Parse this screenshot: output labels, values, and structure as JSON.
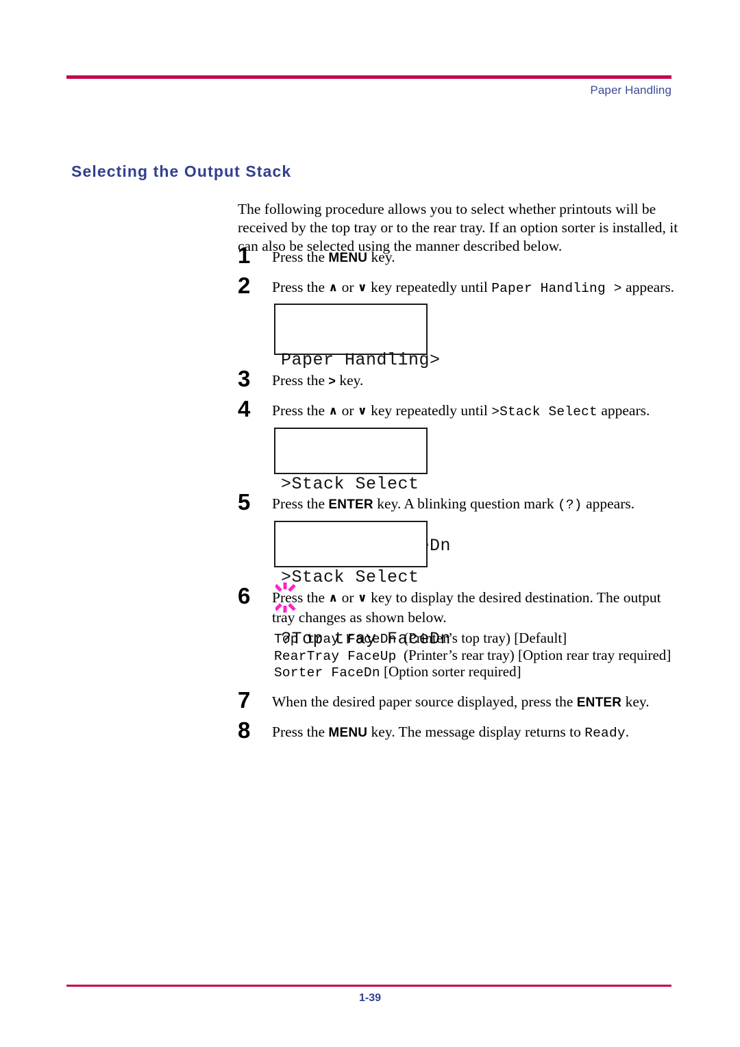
{
  "header": {
    "running_head": "Paper Handling",
    "rule_color": "#c4004c",
    "text_color": "#3b4b96"
  },
  "section": {
    "heading": "Selecting the Output Stack",
    "heading_color": "#31408e"
  },
  "intro": {
    "paragraph": "The following procedure allows you to select whether printouts will be received by the top tray or to the rear tray. If an option sorter is installed, it can also be selected using the manner described below."
  },
  "steps": [
    {
      "number": "1",
      "text_before": "Press the ",
      "key": "MENU",
      "text_after": " key."
    },
    {
      "number": "2",
      "text_before": "Press the ",
      "up_key": "∧",
      "or_text": " or ",
      "down_key": "∨",
      "text_mid": " key repeatedly until ",
      "code": "Paper Handling >",
      "text_after": " appears."
    },
    {
      "number": "3",
      "text_before": "Press the ",
      "key": ">",
      "text_after": " key."
    },
    {
      "number": "4",
      "text_before": "Press the ",
      "up_key": "∧",
      "or_text": " or ",
      "down_key": "∨",
      "text_mid": " key repeatedly until ",
      "code": ">Stack Select",
      "text_after": " appears."
    },
    {
      "number": "5",
      "text_before": "Press the ",
      "key": "ENTER",
      "text_mid": " key. A blinking question mark ",
      "code": "(?)",
      "text_after": " appears."
    },
    {
      "number": "6",
      "text_before": "Press the ",
      "up_key": "∧",
      "or_text": " or ",
      "down_key": "∨",
      "text_after": " key to display the desired destination. The output tray changes as shown below."
    },
    {
      "number": "7",
      "text_before": "When the desired paper source displayed, press the ",
      "key": "ENTER",
      "text_after": " key."
    },
    {
      "number": "8",
      "text_before": "Press the ",
      "key": "MENU",
      "text_mid": " key. The message display returns to ",
      "code": "Ready",
      "text_after": "."
    }
  ],
  "lcd_panels": [
    {
      "line1": "Paper Handling>",
      "line2": ""
    },
    {
      "line1": ">Stack Select",
      "line2": " Top tray FaceDn"
    },
    {
      "line1": ">Stack Select",
      "line2": "?Top tray FaceDn",
      "blink_color": "#ff22cc"
    }
  ],
  "options": [
    {
      "code": "Top tray FaceDn",
      "desc": "(Printer’s top tray) [Default]"
    },
    {
      "code": "RearTray FaceUp",
      "desc": "(Printer’s rear tray) [Option rear tray required]"
    },
    {
      "code": "Sorter FaceDn",
      "desc": "[Option sorter required]"
    }
  ],
  "footer": {
    "page_number": "1-39",
    "rule_color": "#c4004c",
    "text_color": "#31408e"
  }
}
